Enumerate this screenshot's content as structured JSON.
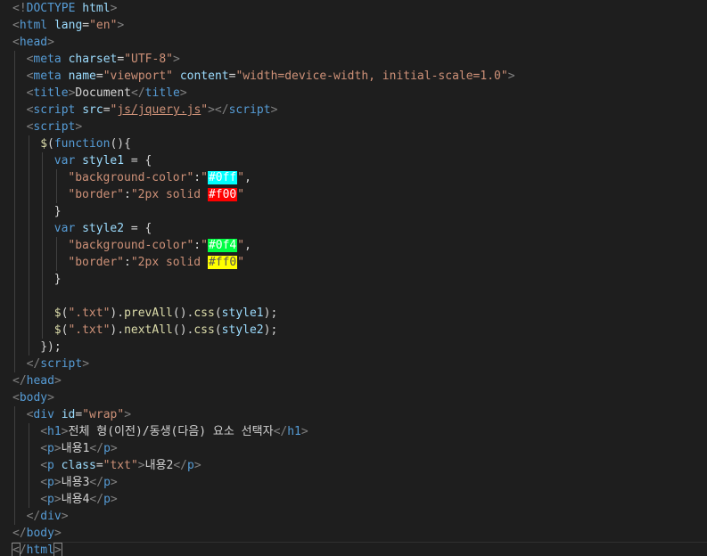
{
  "editor": {
    "lines": [
      {
        "indent": 0,
        "tokens": [
          {
            "t": "<!",
            "c": "bracket"
          },
          {
            "t": "DOCTYPE",
            "c": "tag"
          },
          {
            "t": " html",
            "c": "attr"
          },
          {
            "t": ">",
            "c": "bracket"
          }
        ]
      },
      {
        "indent": 0,
        "tokens": [
          {
            "t": "<",
            "c": "bracket"
          },
          {
            "t": "html",
            "c": "tag"
          },
          {
            "t": " ",
            "c": "txt"
          },
          {
            "t": "lang",
            "c": "attr"
          },
          {
            "t": "=",
            "c": "punc"
          },
          {
            "t": "\"en\"",
            "c": "str"
          },
          {
            "t": ">",
            "c": "bracket"
          }
        ]
      },
      {
        "indent": 0,
        "tokens": [
          {
            "t": "<",
            "c": "bracket"
          },
          {
            "t": "head",
            "c": "tag"
          },
          {
            "t": ">",
            "c": "bracket"
          }
        ]
      },
      {
        "indent": 1,
        "tokens": [
          {
            "t": "<",
            "c": "bracket"
          },
          {
            "t": "meta",
            "c": "tag"
          },
          {
            "t": " ",
            "c": "txt"
          },
          {
            "t": "charset",
            "c": "attr"
          },
          {
            "t": "=",
            "c": "punc"
          },
          {
            "t": "\"UTF-8\"",
            "c": "str"
          },
          {
            "t": ">",
            "c": "bracket"
          }
        ]
      },
      {
        "indent": 1,
        "tokens": [
          {
            "t": "<",
            "c": "bracket"
          },
          {
            "t": "meta",
            "c": "tag"
          },
          {
            "t": " ",
            "c": "txt"
          },
          {
            "t": "name",
            "c": "attr"
          },
          {
            "t": "=",
            "c": "punc"
          },
          {
            "t": "\"viewport\"",
            "c": "str"
          },
          {
            "t": " ",
            "c": "txt"
          },
          {
            "t": "content",
            "c": "attr"
          },
          {
            "t": "=",
            "c": "punc"
          },
          {
            "t": "\"width=device-width, initial-scale=1.0\"",
            "c": "str"
          },
          {
            "t": ">",
            "c": "bracket"
          }
        ]
      },
      {
        "indent": 1,
        "tokens": [
          {
            "t": "<",
            "c": "bracket"
          },
          {
            "t": "title",
            "c": "tag"
          },
          {
            "t": ">",
            "c": "bracket"
          },
          {
            "t": "Document",
            "c": "txt"
          },
          {
            "t": "</",
            "c": "bracket"
          },
          {
            "t": "title",
            "c": "tag"
          },
          {
            "t": ">",
            "c": "bracket"
          }
        ]
      },
      {
        "indent": 1,
        "tokens": [
          {
            "t": "<",
            "c": "bracket"
          },
          {
            "t": "script",
            "c": "tag"
          },
          {
            "t": " ",
            "c": "txt"
          },
          {
            "t": "src",
            "c": "attr"
          },
          {
            "t": "=",
            "c": "punc"
          },
          {
            "t": "\"",
            "c": "str"
          },
          {
            "t": "js/jquery.js",
            "c": "str link"
          },
          {
            "t": "\"",
            "c": "str"
          },
          {
            "t": "></",
            "c": "bracket"
          },
          {
            "t": "script",
            "c": "tag"
          },
          {
            "t": ">",
            "c": "bracket"
          }
        ]
      },
      {
        "indent": 1,
        "tokens": [
          {
            "t": "<",
            "c": "bracket"
          },
          {
            "t": "script",
            "c": "tag"
          },
          {
            "t": ">",
            "c": "bracket"
          }
        ]
      },
      {
        "indent": 2,
        "tokens": [
          {
            "t": "$",
            "c": "jq"
          },
          {
            "t": "(",
            "c": "punc"
          },
          {
            "t": "function",
            "c": "kw"
          },
          {
            "t": "(){",
            "c": "punc"
          }
        ]
      },
      {
        "indent": 3,
        "tokens": [
          {
            "t": "var",
            "c": "kw"
          },
          {
            "t": " ",
            "c": "txt"
          },
          {
            "t": "style1",
            "c": "ident"
          },
          {
            "t": " = {",
            "c": "punc"
          }
        ]
      },
      {
        "indent": 4,
        "tokens": [
          {
            "t": "\"background-color\"",
            "c": "str"
          },
          {
            "t": ":",
            "c": "punc"
          },
          {
            "t": "\"",
            "c": "str"
          },
          {
            "t": "#0ff",
            "c": "swatch",
            "bg": "#00ffff",
            "fg": "#ffffff"
          },
          {
            "t": "\"",
            "c": "str"
          },
          {
            "t": ",",
            "c": "punc"
          }
        ]
      },
      {
        "indent": 4,
        "tokens": [
          {
            "t": "\"border\"",
            "c": "str"
          },
          {
            "t": ":",
            "c": "punc"
          },
          {
            "t": "\"2px solid ",
            "c": "str"
          },
          {
            "t": "#f00",
            "c": "swatch",
            "bg": "#ff0000",
            "fg": "#ffffff"
          },
          {
            "t": "\"",
            "c": "str"
          }
        ]
      },
      {
        "indent": 3,
        "tokens": [
          {
            "t": "}",
            "c": "punc"
          }
        ]
      },
      {
        "indent": 3,
        "tokens": [
          {
            "t": "var",
            "c": "kw"
          },
          {
            "t": " ",
            "c": "txt"
          },
          {
            "t": "style2",
            "c": "ident"
          },
          {
            "t": " = {",
            "c": "punc"
          }
        ]
      },
      {
        "indent": 4,
        "tokens": [
          {
            "t": "\"background-color\"",
            "c": "str"
          },
          {
            "t": ":",
            "c": "punc"
          },
          {
            "t": "\"",
            "c": "str"
          },
          {
            "t": "#0f4",
            "c": "swatch",
            "bg": "#00ff44",
            "fg": "#ffffff"
          },
          {
            "t": "\"",
            "c": "str"
          },
          {
            "t": ",",
            "c": "punc"
          }
        ]
      },
      {
        "indent": 4,
        "tokens": [
          {
            "t": "\"border\"",
            "c": "str"
          },
          {
            "t": ":",
            "c": "punc"
          },
          {
            "t": "\"2px solid ",
            "c": "str"
          },
          {
            "t": "#ff0",
            "c": "swatch",
            "bg": "#ffff00",
            "fg": "#555555"
          },
          {
            "t": "\"",
            "c": "str"
          }
        ]
      },
      {
        "indent": 3,
        "tokens": [
          {
            "t": "}",
            "c": "punc"
          }
        ]
      },
      {
        "indent": 3,
        "tokens": []
      },
      {
        "indent": 3,
        "tokens": [
          {
            "t": "$",
            "c": "jq"
          },
          {
            "t": "(",
            "c": "punc"
          },
          {
            "t": "\".txt\"",
            "c": "str"
          },
          {
            "t": ").",
            "c": "punc"
          },
          {
            "t": "prevAll",
            "c": "fn"
          },
          {
            "t": "().",
            "c": "punc"
          },
          {
            "t": "css",
            "c": "fn"
          },
          {
            "t": "(",
            "c": "punc"
          },
          {
            "t": "style1",
            "c": "ident"
          },
          {
            "t": ");",
            "c": "punc"
          }
        ]
      },
      {
        "indent": 3,
        "tokens": [
          {
            "t": "$",
            "c": "jq"
          },
          {
            "t": "(",
            "c": "punc"
          },
          {
            "t": "\".txt\"",
            "c": "str"
          },
          {
            "t": ").",
            "c": "punc"
          },
          {
            "t": "nextAll",
            "c": "fn"
          },
          {
            "t": "().",
            "c": "punc"
          },
          {
            "t": "css",
            "c": "fn"
          },
          {
            "t": "(",
            "c": "punc"
          },
          {
            "t": "style2",
            "c": "ident"
          },
          {
            "t": ");",
            "c": "punc"
          }
        ]
      },
      {
        "indent": 2,
        "tokens": [
          {
            "t": "});",
            "c": "punc"
          }
        ]
      },
      {
        "indent": 1,
        "tokens": [
          {
            "t": "</",
            "c": "bracket"
          },
          {
            "t": "script",
            "c": "tag"
          },
          {
            "t": ">",
            "c": "bracket"
          }
        ]
      },
      {
        "indent": 0,
        "tokens": [
          {
            "t": "</",
            "c": "bracket"
          },
          {
            "t": "head",
            "c": "tag"
          },
          {
            "t": ">",
            "c": "bracket"
          }
        ]
      },
      {
        "indent": 0,
        "tokens": [
          {
            "t": "<",
            "c": "bracket"
          },
          {
            "t": "body",
            "c": "tag"
          },
          {
            "t": ">",
            "c": "bracket"
          }
        ]
      },
      {
        "indent": 1,
        "tokens": [
          {
            "t": "<",
            "c": "bracket"
          },
          {
            "t": "div",
            "c": "tag"
          },
          {
            "t": " ",
            "c": "txt"
          },
          {
            "t": "id",
            "c": "attr"
          },
          {
            "t": "=",
            "c": "punc"
          },
          {
            "t": "\"wrap\"",
            "c": "str"
          },
          {
            "t": ">",
            "c": "bracket"
          }
        ]
      },
      {
        "indent": 2,
        "tokens": [
          {
            "t": "<",
            "c": "bracket"
          },
          {
            "t": "h1",
            "c": "tag"
          },
          {
            "t": ">",
            "c": "bracket"
          },
          {
            "t": "전체 형(이전)/동생(다음) 요소 선택자",
            "c": "txt"
          },
          {
            "t": "</",
            "c": "bracket"
          },
          {
            "t": "h1",
            "c": "tag"
          },
          {
            "t": ">",
            "c": "bracket"
          }
        ]
      },
      {
        "indent": 2,
        "tokens": [
          {
            "t": "<",
            "c": "bracket"
          },
          {
            "t": "p",
            "c": "tag"
          },
          {
            "t": ">",
            "c": "bracket"
          },
          {
            "t": "내용1",
            "c": "txt"
          },
          {
            "t": "</",
            "c": "bracket"
          },
          {
            "t": "p",
            "c": "tag"
          },
          {
            "t": ">",
            "c": "bracket"
          }
        ]
      },
      {
        "indent": 2,
        "tokens": [
          {
            "t": "<",
            "c": "bracket"
          },
          {
            "t": "p",
            "c": "tag"
          },
          {
            "t": " ",
            "c": "txt"
          },
          {
            "t": "class",
            "c": "attr"
          },
          {
            "t": "=",
            "c": "punc"
          },
          {
            "t": "\"txt\"",
            "c": "str"
          },
          {
            "t": ">",
            "c": "bracket"
          },
          {
            "t": "내용2",
            "c": "txt"
          },
          {
            "t": "</",
            "c": "bracket"
          },
          {
            "t": "p",
            "c": "tag"
          },
          {
            "t": ">",
            "c": "bracket"
          }
        ]
      },
      {
        "indent": 2,
        "tokens": [
          {
            "t": "<",
            "c": "bracket"
          },
          {
            "t": "p",
            "c": "tag"
          },
          {
            "t": ">",
            "c": "bracket"
          },
          {
            "t": "내용3",
            "c": "txt"
          },
          {
            "t": "</",
            "c": "bracket"
          },
          {
            "t": "p",
            "c": "tag"
          },
          {
            "t": ">",
            "c": "bracket"
          }
        ]
      },
      {
        "indent": 2,
        "tokens": [
          {
            "t": "<",
            "c": "bracket"
          },
          {
            "t": "p",
            "c": "tag"
          },
          {
            "t": ">",
            "c": "bracket"
          },
          {
            "t": "내용4",
            "c": "txt"
          },
          {
            "t": "</",
            "c": "bracket"
          },
          {
            "t": "p",
            "c": "tag"
          },
          {
            "t": ">",
            "c": "bracket"
          }
        ]
      },
      {
        "indent": 1,
        "tokens": [
          {
            "t": "</",
            "c": "bracket"
          },
          {
            "t": "div",
            "c": "tag"
          },
          {
            "t": ">",
            "c": "bracket"
          }
        ]
      },
      {
        "indent": 0,
        "tokens": [
          {
            "t": "</",
            "c": "bracket"
          },
          {
            "t": "body",
            "c": "tag"
          },
          {
            "t": ">",
            "c": "bracket"
          }
        ]
      },
      {
        "indent": 0,
        "cursor": true,
        "tokens": [
          {
            "t": "<",
            "c": "bracket match"
          },
          {
            "t": "/",
            "c": "bracket"
          },
          {
            "t": "html",
            "c": "tag"
          },
          {
            "t": ">",
            "c": "bracket match"
          }
        ]
      }
    ]
  }
}
